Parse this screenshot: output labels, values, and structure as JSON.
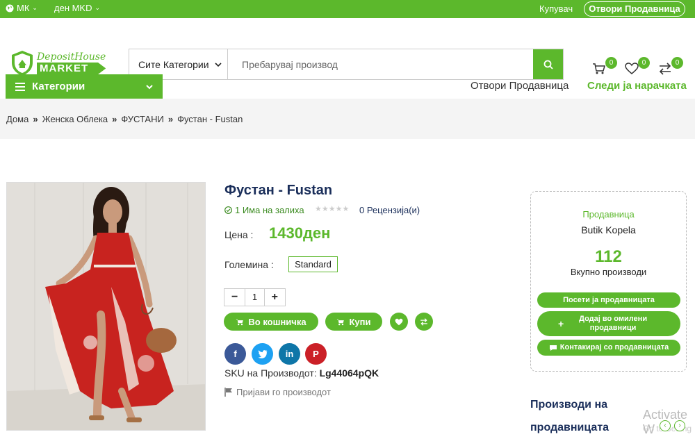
{
  "topbar": {
    "language": "МК",
    "currency": "ден MKD",
    "buyer": "Купувач",
    "open_store": "Отвори Продавница"
  },
  "header": {
    "logo_line1": "DepositHouse",
    "logo_line2": "MARKET",
    "search_category": "Сите Категории",
    "search_placeholder": "Пребарувај производ",
    "cart_count": "0",
    "wishlist_count": "0",
    "compare_count": "0"
  },
  "nav": {
    "categories": "Категории",
    "open_store": "Отвори Продавница",
    "track_order": "Следи ја нарачката"
  },
  "breadcrumb": [
    "Дома",
    "Женска Облека",
    "ФУСТАНИ",
    "Фустан - Fustan"
  ],
  "product": {
    "title": "Фустан - Fustan",
    "stock": "1 Има на залиха",
    "reviews": "0 Рецензија(и)",
    "price_label": "Цена :",
    "price": "1430ден",
    "size_label": "Големина :",
    "size": "Standard",
    "quantity": "1",
    "add_to_cart": "Во кошничка",
    "buy": "Купи",
    "sku_label": "SKU на Производот:",
    "sku": "Lg44064pQK",
    "report": "Пријави го производот"
  },
  "vendor": {
    "label": "Продавница",
    "name": "Butik Kopela",
    "products_count": "112",
    "products_label": "Вкупно производи",
    "visit": "Посети ја продавницата",
    "add_favorite": "Додај во омилени продавници",
    "contact": "Контакирај со продавницата"
  },
  "more": {
    "title": "Производи на продавницата"
  },
  "watermark": {
    "line1": "Activate W",
    "line2": "Go to Setting"
  },
  "colors": {
    "brand_green": "#5cb82c",
    "title_navy": "#1a2e5a",
    "facebook": "#3b5998",
    "twitter": "#1da1f2",
    "linkedin": "#0e76a8",
    "pinterest": "#cb2027"
  }
}
